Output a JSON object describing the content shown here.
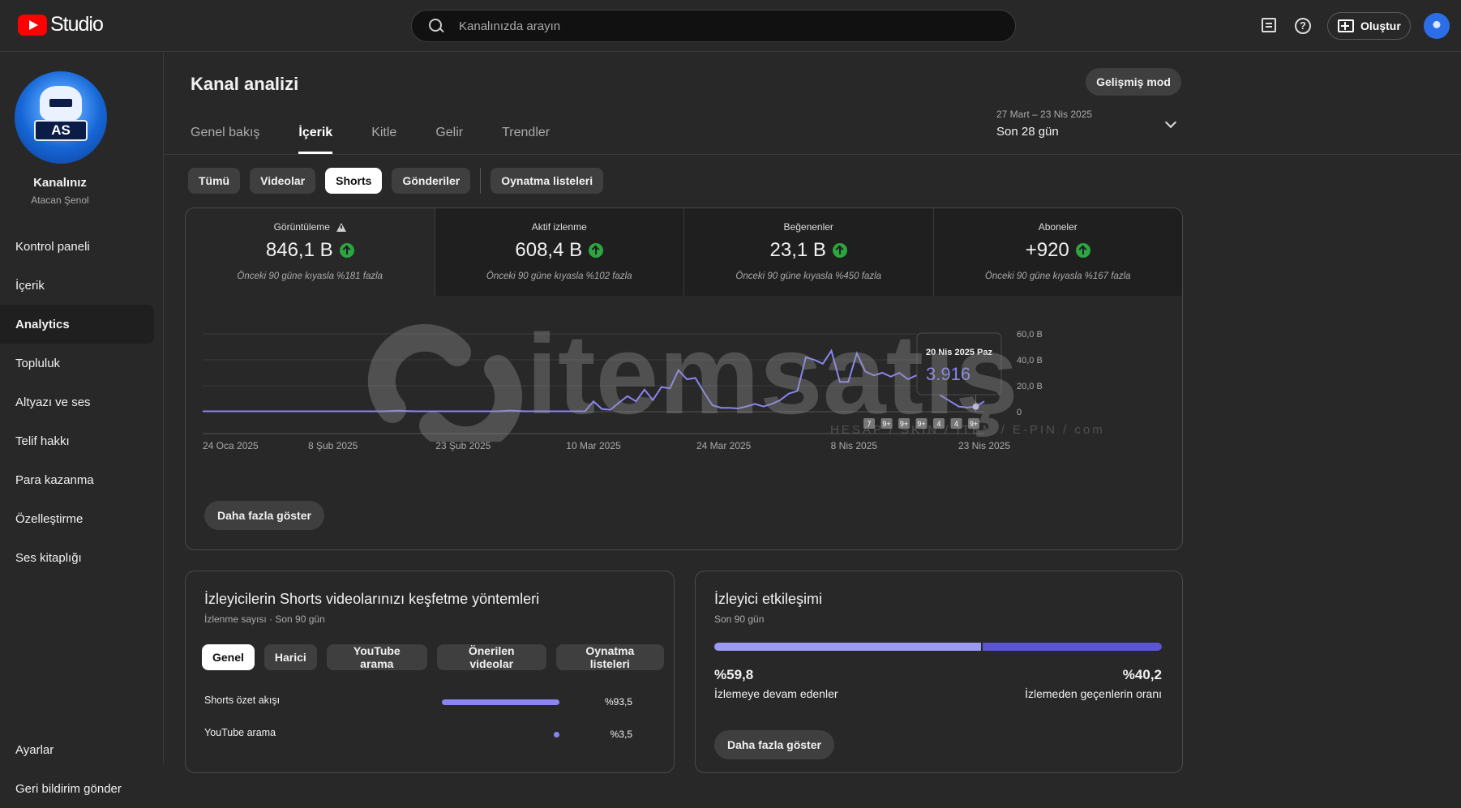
{
  "app": {
    "logo_text": "Studio"
  },
  "search": {
    "placeholder": "Kanalınızda arayın"
  },
  "header": {
    "create_label": "Oluştur"
  },
  "sidebar": {
    "channel_name": "Kanalınız",
    "channel_handle": "Atacan Şenol",
    "channel_badge": "AS",
    "items": [
      {
        "label": "Kontrol paneli"
      },
      {
        "label": "İçerik"
      },
      {
        "label": "Analytics"
      },
      {
        "label": "Topluluk"
      },
      {
        "label": "Altyazı ve ses"
      },
      {
        "label": "Telif hakkı"
      },
      {
        "label": "Para kazanma"
      },
      {
        "label": "Özelleştirme"
      },
      {
        "label": "Ses kitaplığı"
      }
    ],
    "bottom_items": [
      {
        "label": "Ayarlar"
      },
      {
        "label": "Geri bildirim gönder"
      }
    ]
  },
  "page": {
    "title": "Kanal analizi",
    "advanced_label": "Gelişmiş mod",
    "tabs": [
      {
        "label": "Genel bakış"
      },
      {
        "label": "İçerik"
      },
      {
        "label": "Kitle"
      },
      {
        "label": "Gelir"
      },
      {
        "label": "Trendler"
      }
    ],
    "date_range": "27 Mart – 23 Nis 2025",
    "date_label": "Son 28 gün",
    "chips": [
      {
        "label": "Tümü"
      },
      {
        "label": "Videolar"
      },
      {
        "label": "Shorts"
      },
      {
        "label": "Gönderiler"
      },
      {
        "label": "Oynatma listeleri"
      }
    ]
  },
  "metrics": [
    {
      "label": "Görüntüleme",
      "value": "846,1 B",
      "sub": "Önceki 90 güne kıyasla %181 fazla"
    },
    {
      "label": "Aktif izlenme",
      "value": "608,4 B",
      "sub": "Önceki 90 güne kıyasla %102 fazla"
    },
    {
      "label": "Beğenenler",
      "value": "23,1 B",
      "sub": "Önceki 90 güne kıyasla %450 fazla"
    },
    {
      "label": "Aboneler",
      "value": "+920",
      "sub": "Önceki 90 güne kıyasla %167 fazla"
    }
  ],
  "main_more_label": "Daha fazla göster",
  "chart_data": {
    "type": "line",
    "x_ticks": [
      "24 Oca 2025",
      "8 Şub 2025",
      "23 Şub 2025",
      "10 Mar 2025",
      "24 Mar 2025",
      "8 Nis 2025",
      "23 Nis 2025"
    ],
    "y_ticks": [
      "60,0 B",
      "40,0 B",
      "20,0 B",
      "0"
    ],
    "ylim": [
      0,
      60000
    ],
    "series_color": "#8a85f2",
    "values": [
      300,
      300,
      300,
      300,
      300,
      300,
      300,
      300,
      300,
      300,
      300,
      300,
      300,
      300,
      300,
      300,
      300,
      300,
      300,
      300,
      300,
      300,
      500,
      800,
      500,
      300,
      300,
      300,
      300,
      300,
      300,
      300,
      300,
      300,
      300,
      400,
      900,
      600,
      300,
      300,
      300,
      300,
      300,
      300,
      300,
      300,
      8000,
      2000,
      1500,
      7000,
      12000,
      8000,
      17000,
      9000,
      19000,
      18000,
      32000,
      25000,
      26000,
      15000,
      5000,
      3000,
      3000,
      2500,
      4000,
      6000,
      4000,
      6000,
      9000,
      14000,
      16000,
      42000,
      40000,
      37000,
      47000,
      23000,
      23000,
      45000,
      31000,
      28000,
      30000,
      27000,
      30000,
      25000,
      28000,
      24000,
      16000,
      12000,
      8000,
      4000,
      3200,
      3916,
      8000
    ],
    "tooltip": {
      "date": "20 Nis 2025 Paz",
      "value": "3.916"
    },
    "markers": [
      "7",
      "9+",
      "9+",
      "9+",
      "4",
      "4",
      "9+"
    ]
  },
  "discover": {
    "title": "İzleyicilerin Shorts videolarınızı keşfetme yöntemleri",
    "subtitle": "İzlenme sayısı · Son 90 gün",
    "chips": [
      {
        "label": "Genel"
      },
      {
        "label": "Harici"
      },
      {
        "label": "YouTube arama"
      },
      {
        "label": "Önerilen videolar"
      },
      {
        "label": "Oynatma listeleri"
      }
    ],
    "rows": [
      {
        "label": "Shorts özet akışı",
        "pct": "%93,5",
        "fraction": 0.935
      },
      {
        "label": "YouTube arama",
        "pct": "%3,5",
        "fraction": 0.035
      }
    ]
  },
  "engagement": {
    "title": "İzleyici etkileşimi",
    "subtitle": "Son 90 gün",
    "left_value": "%59,8",
    "left_label": "İzlemeye devam edenler",
    "right_value": "%40,2",
    "right_label": "İzlemeden geçenlerin oranı",
    "left_fraction": 0.598,
    "more_label": "Daha fazla göster"
  },
  "watermark": {
    "text": "itemsatış",
    "subtext": "HESAP / SKIN / ITEM / E-PIN / com"
  }
}
